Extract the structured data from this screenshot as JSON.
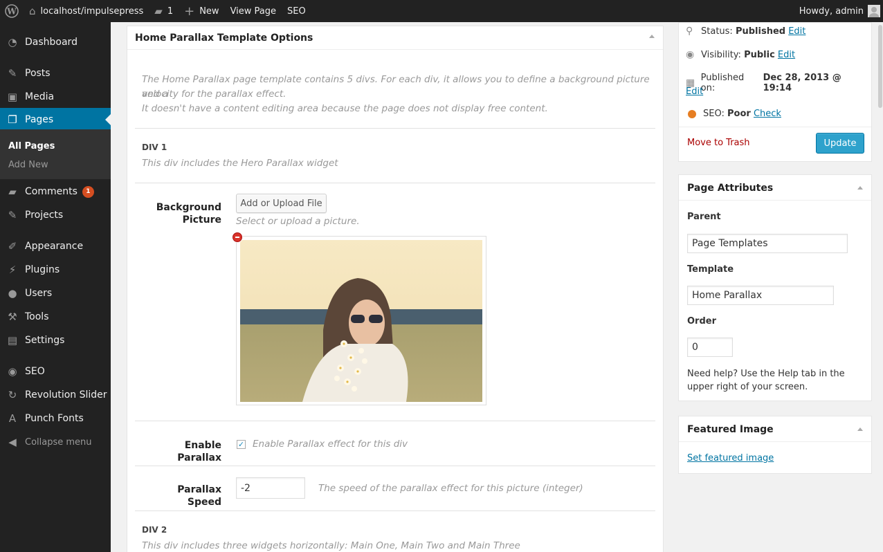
{
  "adminbar": {
    "site": "localhost/impulsepress",
    "comments_count": "1",
    "new_label": "New",
    "view_page": "View Page",
    "seo": "SEO",
    "howdy": "Howdy, admin"
  },
  "sidebar": {
    "items": [
      {
        "label": "Dashboard",
        "icon": "dashboard-icon"
      },
      {
        "label": "Posts",
        "icon": "pin-icon"
      },
      {
        "label": "Media",
        "icon": "media-icon"
      },
      {
        "label": "Pages",
        "icon": "pages-icon"
      },
      {
        "label": "Comments",
        "icon": "comment-icon",
        "badge": "1"
      },
      {
        "label": "Projects",
        "icon": "pin-icon"
      },
      {
        "label": "Appearance",
        "icon": "brush-icon"
      },
      {
        "label": "Plugins",
        "icon": "plug-icon"
      },
      {
        "label": "Users",
        "icon": "user-icon"
      },
      {
        "label": "Tools",
        "icon": "wrench-icon"
      },
      {
        "label": "Settings",
        "icon": "settings-icon"
      },
      {
        "label": "SEO",
        "icon": "seo-icon"
      },
      {
        "label": "Revolution Slider",
        "icon": "refresh-icon"
      },
      {
        "label": "Punch Fonts",
        "icon": "font-icon"
      }
    ],
    "submenu": [
      "All Pages",
      "Add New"
    ],
    "collapse": "Collapse menu"
  },
  "main": {
    "box_title": "Home Parallax Template Options",
    "intro_line1": "The Home Parallax page template contains 5 divs. For each div, it allows you to define a background picture and a",
    "intro_line2": "velocity for the parallax effect.",
    "intro_line3": "It doesn't have a content editing area because the page does not display free content.",
    "div1_title": "DIV 1",
    "div1_desc": "This div includes the Hero Parallax widget",
    "bg_label_1": "Background",
    "bg_label_2": "Picture",
    "upload_button": "Add or Upload File",
    "upload_hint": "Select or upload a picture.",
    "enable_parallax_label": "Enable Parallax",
    "enable_parallax_hint": "Enable Parallax effect for this div",
    "enable_parallax_checked": true,
    "parallax_speed_label": "Parallax Speed",
    "parallax_speed_value": "-2",
    "parallax_speed_hint": "The speed of the parallax effect for this picture (integer)",
    "div2_title": "DIV 2",
    "div2_desc": "This div includes three widgets horizontally: Main One, Main Two and Main Three"
  },
  "publish": {
    "status_label": "Status:",
    "status_value": "Published",
    "visibility_label": "Visibility:",
    "visibility_value": "Public",
    "published_label": "Published on:",
    "published_value": "Dec 28, 2013 @ 19:14",
    "edit": "Edit",
    "seo_label": "SEO:",
    "seo_value": "Poor",
    "seo_check": "Check",
    "trash": "Move to Trash",
    "update": "Update"
  },
  "attributes": {
    "title": "Page Attributes",
    "parent_label": "Parent",
    "parent_value": "Page Templates",
    "template_label": "Template",
    "template_value": "Home Parallax",
    "order_label": "Order",
    "order_value": "0",
    "help_text": "Need help? Use the Help tab in the upper right of your screen."
  },
  "featured": {
    "title": "Featured Image",
    "link": "Set featured image"
  },
  "colors": {
    "adminbar": "#222222",
    "sidebar": "#222222",
    "current": "#0074a2",
    "primary_button": "#2ea2cc",
    "link": "#0074a2",
    "seo_dot": "#e67e22",
    "trash": "#aa0000"
  }
}
